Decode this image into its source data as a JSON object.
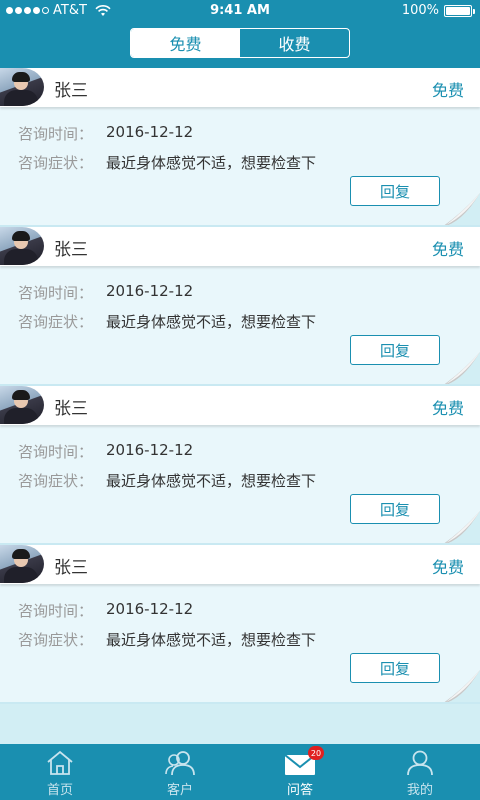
{
  "status_bar": {
    "carrier": "AT&T",
    "time": "9:41 AM",
    "battery": "100%",
    "battery_level": 1.0
  },
  "segment": {
    "tabs": [
      "免费",
      "收费"
    ],
    "selected": "免费"
  },
  "consultations": [
    {
      "name": "张三",
      "tag": "免费",
      "time_label": "咨询时间：",
      "time_value": "2016-12-12",
      "symptom_label": "咨询症状：",
      "symptom_value": "最近身体感觉不适，想要检查下",
      "reply_label": "回复"
    },
    {
      "name": "张三",
      "tag": "免费",
      "time_label": "咨询时间：",
      "time_value": "2016-12-12",
      "symptom_label": "咨询症状：",
      "symptom_value": "最近身体感觉不适，想要检查下",
      "reply_label": "回复"
    },
    {
      "name": "张三",
      "tag": "免费",
      "time_label": "咨询时间：",
      "time_value": "2016-12-12",
      "symptom_label": "咨询症状：",
      "symptom_value": "最近身体感觉不适，想要检查下",
      "reply_label": "回复"
    },
    {
      "name": "张三",
      "tag": "免费",
      "time_label": "咨询时间：",
      "time_value": "2016-12-12",
      "symptom_label": "咨询症状：",
      "symptom_value": "最近身体感觉不适，想要检查下",
      "reply_label": "回复"
    }
  ],
  "tab_bar": {
    "items": [
      {
        "label": "首页",
        "icon": "home-icon"
      },
      {
        "label": "客户",
        "icon": "clients-icon"
      },
      {
        "label": "问答",
        "icon": "mail-icon"
      },
      {
        "label": "我的",
        "icon": "profile-icon"
      }
    ],
    "active": "问答",
    "badge_count": "20"
  },
  "colors": {
    "primary": "#1a8fb0",
    "background": "#d2eef4",
    "card": "#e9f7fb",
    "badge": "#e02020"
  }
}
